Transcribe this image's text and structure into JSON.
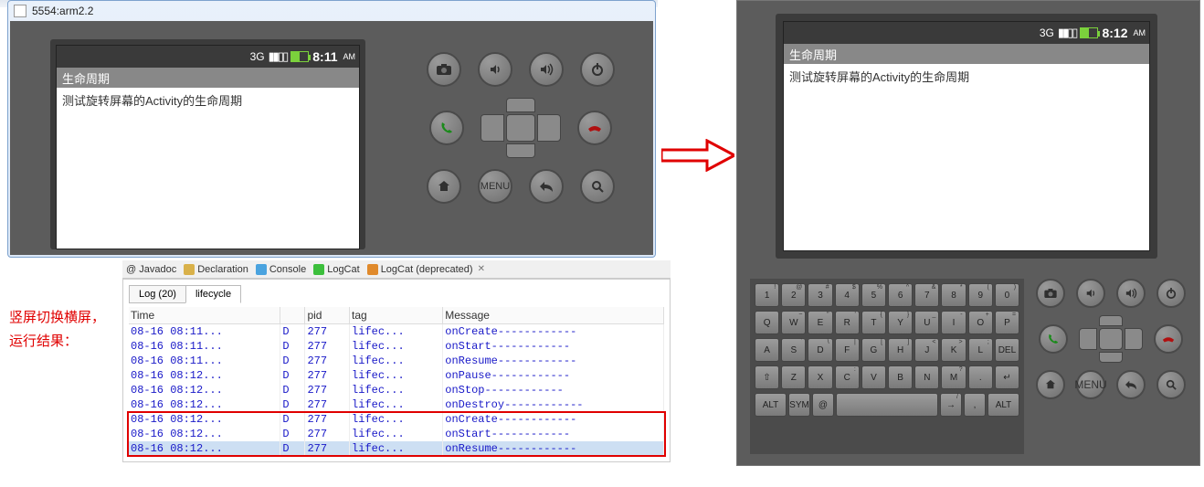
{
  "emulator_portrait": {
    "window_title": "5554:arm2.2",
    "statusbar": {
      "time": "8:11",
      "ampm": "AM",
      "net": "3G"
    },
    "app_title": "生命周期",
    "app_text": "测试旋转屏幕的Activity的生命周期"
  },
  "emulator_landscape": {
    "statusbar": {
      "time": "8:12",
      "ampm": "AM",
      "net": "3G"
    },
    "app_title": "生命周期",
    "app_text": "测试旋转屏幕的Activity的生命周期"
  },
  "control_buttons": {
    "camera": "camera-icon",
    "vol_down": "volume-down-icon",
    "vol_up": "volume-up-icon",
    "power": "power-icon",
    "call": "call-icon",
    "end": "end-call-icon",
    "home": "home-icon",
    "menu_label": "MENU",
    "back": "back-icon",
    "search": "search-icon"
  },
  "keyboard": {
    "row1": [
      {
        "main": "1",
        "sup": "!"
      },
      {
        "main": "2",
        "sup": "@"
      },
      {
        "main": "3",
        "sup": "#"
      },
      {
        "main": "4",
        "sup": "$"
      },
      {
        "main": "5",
        "sup": "%"
      },
      {
        "main": "6",
        "sup": "^"
      },
      {
        "main": "7",
        "sup": "&"
      },
      {
        "main": "8",
        "sup": "*"
      },
      {
        "main": "9",
        "sup": "("
      },
      {
        "main": "0",
        "sup": ")"
      }
    ],
    "row2": [
      {
        "main": "Q"
      },
      {
        "main": "W",
        "sup": "~"
      },
      {
        "main": "E",
        "sup": "\""
      },
      {
        "main": "R",
        "sup": "'"
      },
      {
        "main": "T",
        "sup": "{"
      },
      {
        "main": "Y",
        "sup": "}"
      },
      {
        "main": "U",
        "sup": "_"
      },
      {
        "main": "I",
        "sup": "-"
      },
      {
        "main": "O",
        "sup": "+"
      },
      {
        "main": "P",
        "sup": "="
      }
    ],
    "row3": [
      {
        "main": "A"
      },
      {
        "main": "S",
        "sup": "`"
      },
      {
        "main": "D",
        "sup": "\\"
      },
      {
        "main": "F",
        "sup": "|"
      },
      {
        "main": "G",
        "sup": "["
      },
      {
        "main": "H",
        "sup": "]"
      },
      {
        "main": "J",
        "sup": "<"
      },
      {
        "main": "K",
        "sup": ">"
      },
      {
        "main": "L",
        "sup": ";"
      },
      {
        "main": "DEL",
        "sup": ""
      }
    ],
    "row4": [
      {
        "main": "⇧"
      },
      {
        "main": "Z"
      },
      {
        "main": "X"
      },
      {
        "main": "C",
        "sup": ":"
      },
      {
        "main": "V"
      },
      {
        "main": "B"
      },
      {
        "main": "N"
      },
      {
        "main": "M",
        "sup": "?"
      },
      {
        "main": "."
      },
      {
        "main": "↵"
      }
    ],
    "row5": [
      {
        "main": "ALT",
        "cls": "half"
      },
      {
        "main": "SYM"
      },
      {
        "main": "@"
      },
      {
        "main": "",
        "cls": "wide"
      },
      {
        "main": "→",
        "sup": "/"
      },
      {
        "main": ",",
        "sup": ""
      },
      {
        "main": "ALT",
        "cls": "half"
      }
    ]
  },
  "caption": {
    "line1": "竖屏切换横屏，",
    "line2": "运行结果："
  },
  "ide": {
    "views": [
      "@ Javadoc",
      "Declaration",
      "Console",
      "LogCat",
      "LogCat (deprecated)"
    ],
    "filter_tabs": {
      "log": "Log (20)",
      "lifecycle": "lifecycle"
    },
    "columns": {
      "time": "Time",
      "level": "",
      "pid": "pid",
      "tag": "tag",
      "msg": "Message"
    },
    "rows": [
      {
        "time": "08-16 08:11...",
        "lvl": "D",
        "pid": "277",
        "tag": "lifec...",
        "msg": "onCreate------------"
      },
      {
        "time": "08-16 08:11...",
        "lvl": "D",
        "pid": "277",
        "tag": "lifec...",
        "msg": "onStart------------"
      },
      {
        "time": "08-16 08:11...",
        "lvl": "D",
        "pid": "277",
        "tag": "lifec...",
        "msg": "onResume------------"
      },
      {
        "time": "08-16 08:12...",
        "lvl": "D",
        "pid": "277",
        "tag": "lifec...",
        "msg": "onPause------------"
      },
      {
        "time": "08-16 08:12...",
        "lvl": "D",
        "pid": "277",
        "tag": "lifec...",
        "msg": "onStop------------"
      },
      {
        "time": "08-16 08:12...",
        "lvl": "D",
        "pid": "277",
        "tag": "lifec...",
        "msg": "onDestroy------------"
      },
      {
        "time": "08-16 08:12...",
        "lvl": "D",
        "pid": "277",
        "tag": "lifec...",
        "msg": "onCreate------------"
      },
      {
        "time": "08-16 08:12...",
        "lvl": "D",
        "pid": "277",
        "tag": "lifec...",
        "msg": "onStart------------"
      },
      {
        "time": "08-16 08:12...",
        "lvl": "D",
        "pid": "277",
        "tag": "lifec...",
        "msg": "onResume------------"
      }
    ]
  }
}
